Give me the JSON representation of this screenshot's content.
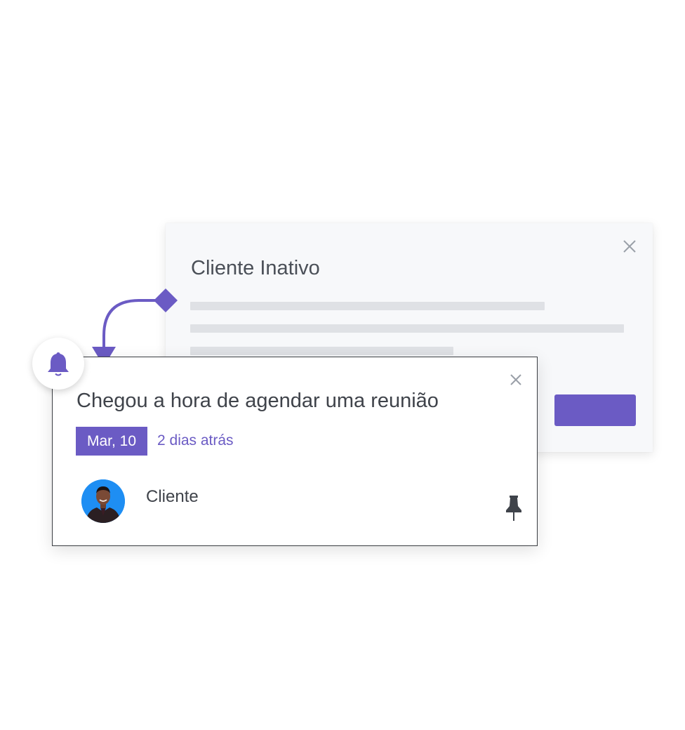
{
  "back_dialog": {
    "title": "Cliente Inativo",
    "close_icon": "close-icon",
    "accent_color": "#6b5bc4"
  },
  "notification": {
    "title": "Chegou a hora de agendar uma reunião",
    "date": "Mar, 10",
    "relative_time": "2 dias atrás",
    "client_label": "Cliente",
    "close_icon": "close-icon",
    "pin_icon": "pin-icon",
    "bell_icon": "bell-icon",
    "accent_color": "#6b5bc4"
  }
}
